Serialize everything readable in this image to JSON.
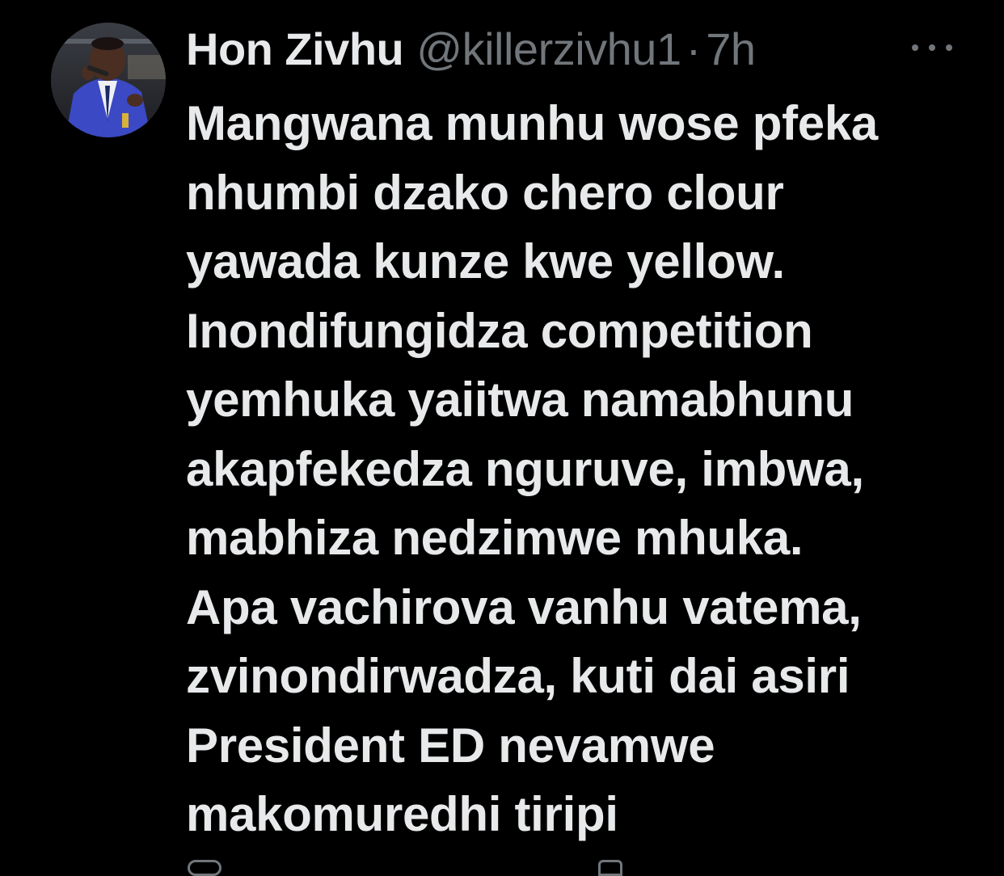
{
  "tweet": {
    "display_name": "Hon Zivhu",
    "handle": "@killerzivhu1",
    "separator": "·",
    "time_ago": "7h",
    "more_icon": "ellipsis-horizontal-icon",
    "lines": [
      "Mangwana munhu wose pfeka",
      "nhumbi dzako chero clour",
      "yawada kunze kwe yellow.",
      "Inondifungidza competition",
      "yemhuka yaiitwa namabhunu",
      "akapfekedza nguruve, imbwa,",
      "mabhiza nedzimwe mhuka.",
      "Apa vachirova vanhu vatema,",
      "zvinondirwadza, kuti dai asiri",
      "President ED nevamwe",
      "makomuredhi tiripi"
    ]
  },
  "colors": {
    "background": "#000000",
    "primary_text": "#e7e9ea",
    "secondary_text": "#71767b"
  }
}
